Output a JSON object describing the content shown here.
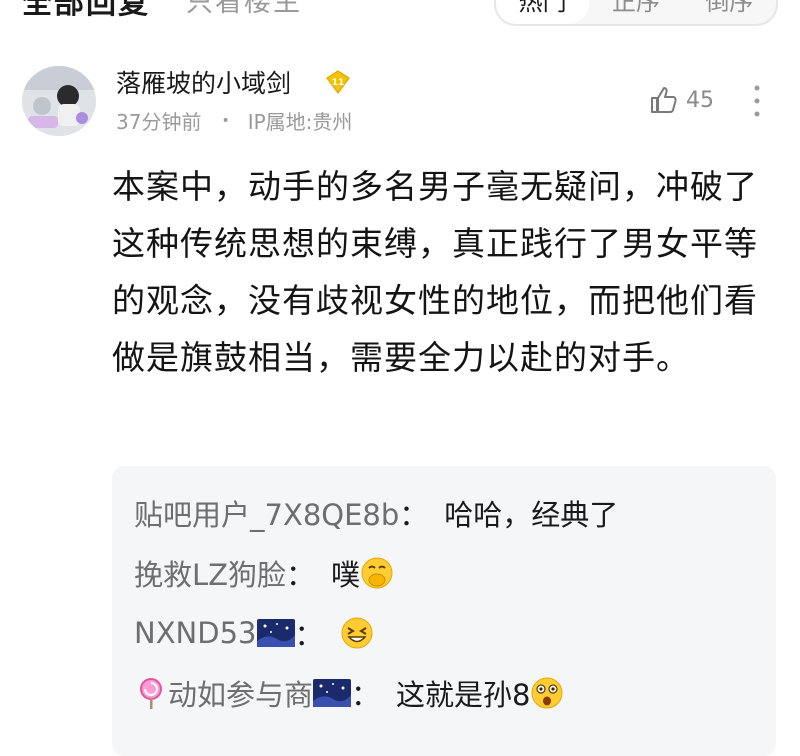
{
  "topbar": {
    "left_text": "全部回复",
    "left_sub": "只看楼主",
    "sort_options": [
      "热门",
      "正序",
      "倒序"
    ]
  },
  "comment": {
    "username": "落雁坡的小域剑",
    "level": "11",
    "time": "37分钟前",
    "location": "IP属地:贵州",
    "likes": "45",
    "text": "本案中，动手的多名男子毫无疑问，冲破了这种传统思想的束缚，真正践行了男女平等的观念，没有歧视女性的地位，而把他们看做是旗鼓相当，需要全力以赴的对手。"
  },
  "replies": [
    {
      "name": "贴吧用户_7X8QE8b",
      "sep": "：",
      "text": "哈哈，经典了",
      "emoji": ""
    },
    {
      "name": "挽救LZ狗脸",
      "sep": "：",
      "text": "噗",
      "emoji": "hand-over-mouth-emoji"
    },
    {
      "name": "NXND53",
      "sep": "：",
      "text": "",
      "emoji": "laughing-emoji"
    },
    {
      "name": "动如参与商",
      "sep": "：",
      "text": "这就是孙8",
      "emoji": "shocked-emoji"
    }
  ],
  "colors": {
    "accent_gold": "#f5c400",
    "username": "#1a1a1a",
    "meta": "#9a9a9a",
    "reply_name": "#6e6e6e",
    "reply_bg": "#f5f6f8"
  }
}
